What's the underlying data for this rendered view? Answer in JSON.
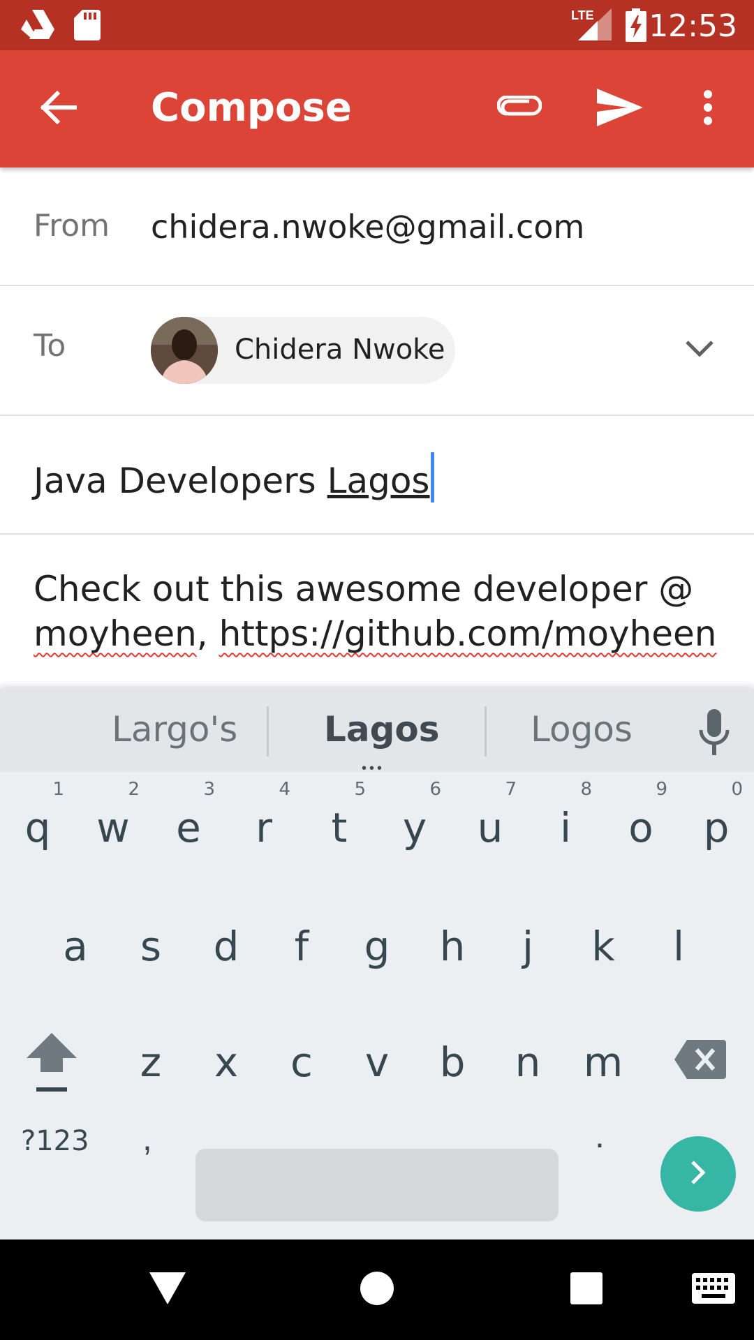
{
  "status_bar": {
    "time": "12:53",
    "network": "LTE",
    "icons": [
      "drive-icon",
      "sd-card-icon",
      "signal-icon",
      "battery-charging-icon"
    ]
  },
  "app_bar": {
    "title": "Compose",
    "icons": [
      "back-arrow-icon",
      "attachment-icon",
      "send-icon",
      "more-vert-icon"
    ]
  },
  "compose": {
    "from_label": "From",
    "from_value": "chidera.nwoke@gmail.com",
    "to_label": "To",
    "recipient_chip": "Chidera Nwoke",
    "subject_prefix": "Java Developers ",
    "subject_composing": "Lagos",
    "body_line1": "Check out this awesome developer @",
    "body_line2_a": "moyheen",
    "body_line2_b": ", ",
    "body_line2_c": "https://github.com/moyheen"
  },
  "keyboard": {
    "suggestions": [
      "Largo's",
      "Lagos",
      "Logos"
    ],
    "row1": [
      {
        "ch": "q",
        "hint": "1"
      },
      {
        "ch": "w",
        "hint": "2"
      },
      {
        "ch": "e",
        "hint": "3"
      },
      {
        "ch": "r",
        "hint": "4"
      },
      {
        "ch": "t",
        "hint": "5"
      },
      {
        "ch": "y",
        "hint": "6"
      },
      {
        "ch": "u",
        "hint": "7"
      },
      {
        "ch": "i",
        "hint": "8"
      },
      {
        "ch": "o",
        "hint": "9"
      },
      {
        "ch": "p",
        "hint": "0"
      }
    ],
    "row2": [
      "a",
      "s",
      "d",
      "f",
      "g",
      "h",
      "j",
      "k",
      "l"
    ],
    "row3": [
      "z",
      "x",
      "c",
      "v",
      "b",
      "n",
      "m"
    ],
    "symbols_label": "?123",
    "comma": ",",
    "period": "."
  },
  "colors": {
    "status_bar": "#b53123",
    "app_bar": "#db4437",
    "enter_key": "#36b6a4",
    "cursor": "#4285f4"
  }
}
